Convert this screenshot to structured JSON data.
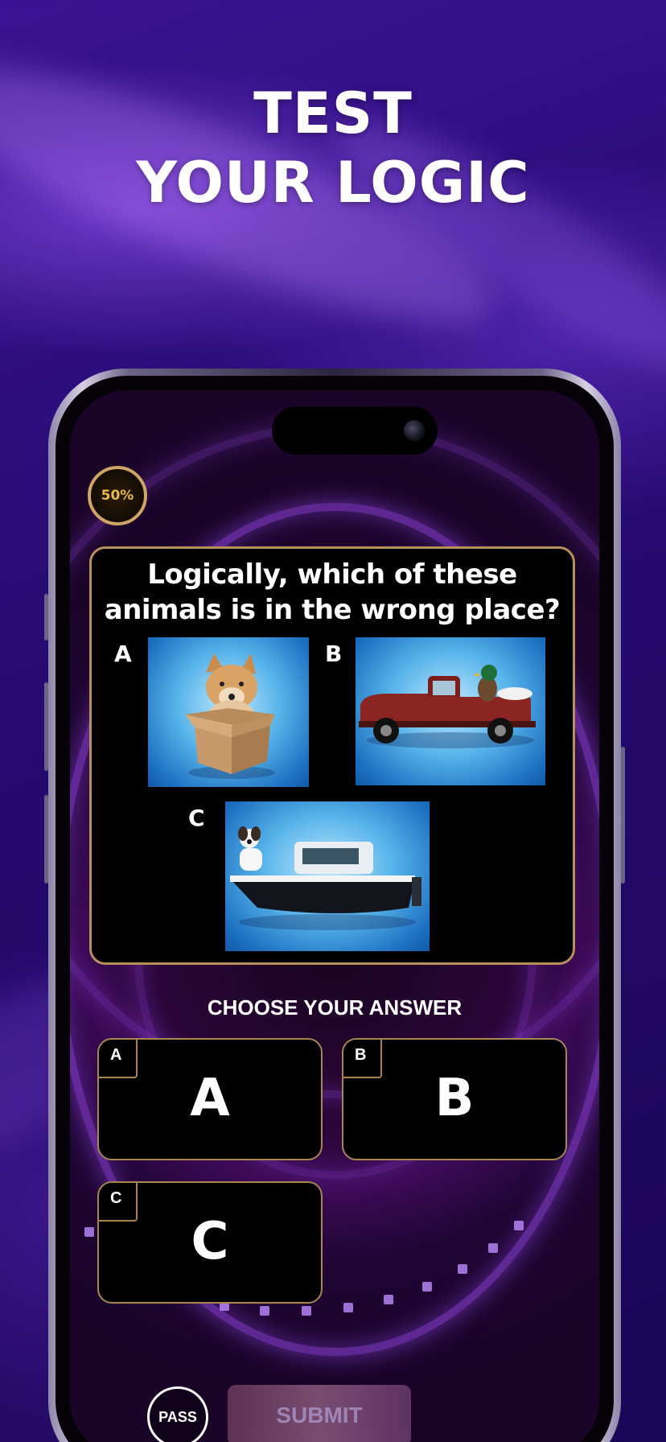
{
  "headline": {
    "line1": "TEST",
    "line2": "YOUR LOGIC"
  },
  "lifeline": {
    "label": "50%"
  },
  "question": {
    "text": "Logically, which of these animals is in the wrong place?",
    "options": [
      {
        "letter": "A",
        "image": "fox-in-cardboard-box"
      },
      {
        "letter": "B",
        "image": "duck-on-red-pickup-truck"
      },
      {
        "letter": "C",
        "image": "dog-on-motor-boat"
      }
    ]
  },
  "choose_label": "CHOOSE YOUR ANSWER",
  "answers": [
    {
      "tag": "A",
      "label": "A"
    },
    {
      "tag": "B",
      "label": "B"
    },
    {
      "tag": "C",
      "label": "C"
    }
  ],
  "actions": {
    "pass_label": "PASS",
    "submit_label": "SUBMIT"
  },
  "colors": {
    "background": "#2a0d78",
    "gold_border": "#b8905a",
    "ring_glow": "#9646e6"
  }
}
